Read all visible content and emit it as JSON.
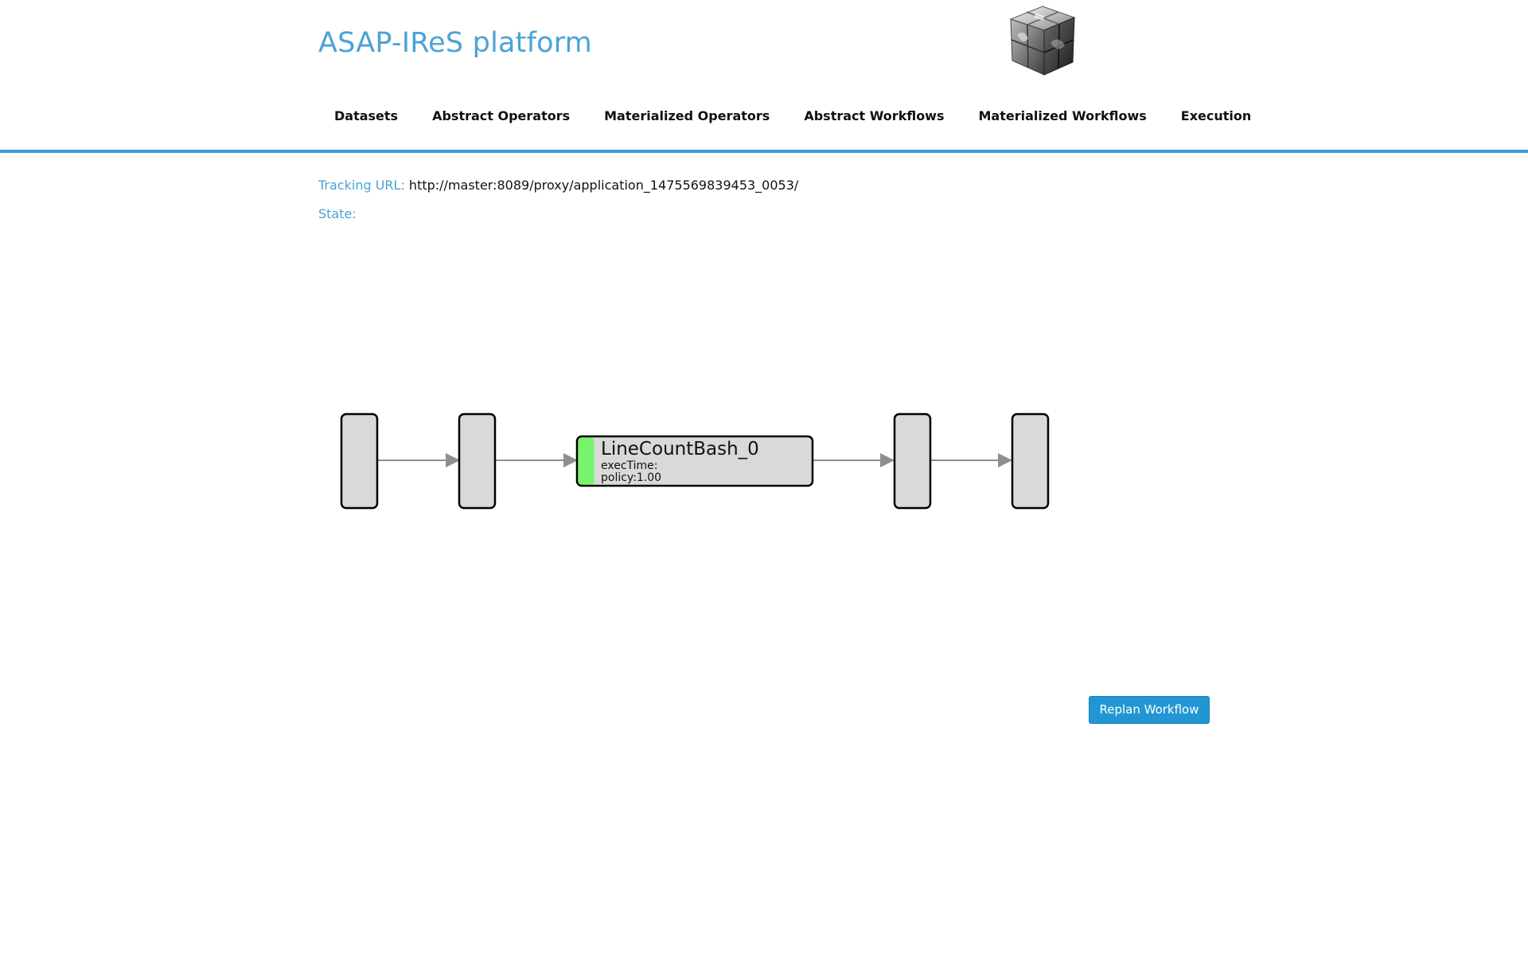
{
  "header": {
    "title": "ASAP-IReS platform",
    "logo_icon": "cube-logo-icon"
  },
  "nav": {
    "items": [
      {
        "label": "Datasets"
      },
      {
        "label": "Abstract Operators"
      },
      {
        "label": "Materialized Operators"
      },
      {
        "label": "Abstract Workflows"
      },
      {
        "label": "Materialized Workflows"
      },
      {
        "label": "Execution"
      }
    ]
  },
  "info": {
    "tracking_label": "Tracking URL:",
    "tracking_value": "http://master:8089/proxy/application_1475569839453_0053/",
    "state_label": "State:",
    "state_value": ""
  },
  "workflow": {
    "nodes": [
      {
        "type": "dataset"
      },
      {
        "type": "dataset"
      },
      {
        "type": "operator",
        "name": "LineCountBash_0",
        "exec_time": "execTime:",
        "policy": "policy:1.00",
        "status_color": "#77f46b"
      },
      {
        "type": "dataset"
      },
      {
        "type": "dataset"
      }
    ]
  },
  "actions": {
    "replan_label": "Replan Workflow"
  },
  "colors": {
    "accent": "#3d9bd7",
    "title": "#4aa3d6",
    "button": "#2196d3",
    "node_fill": "#d9d9d9",
    "edge": "#8f8f8f"
  }
}
